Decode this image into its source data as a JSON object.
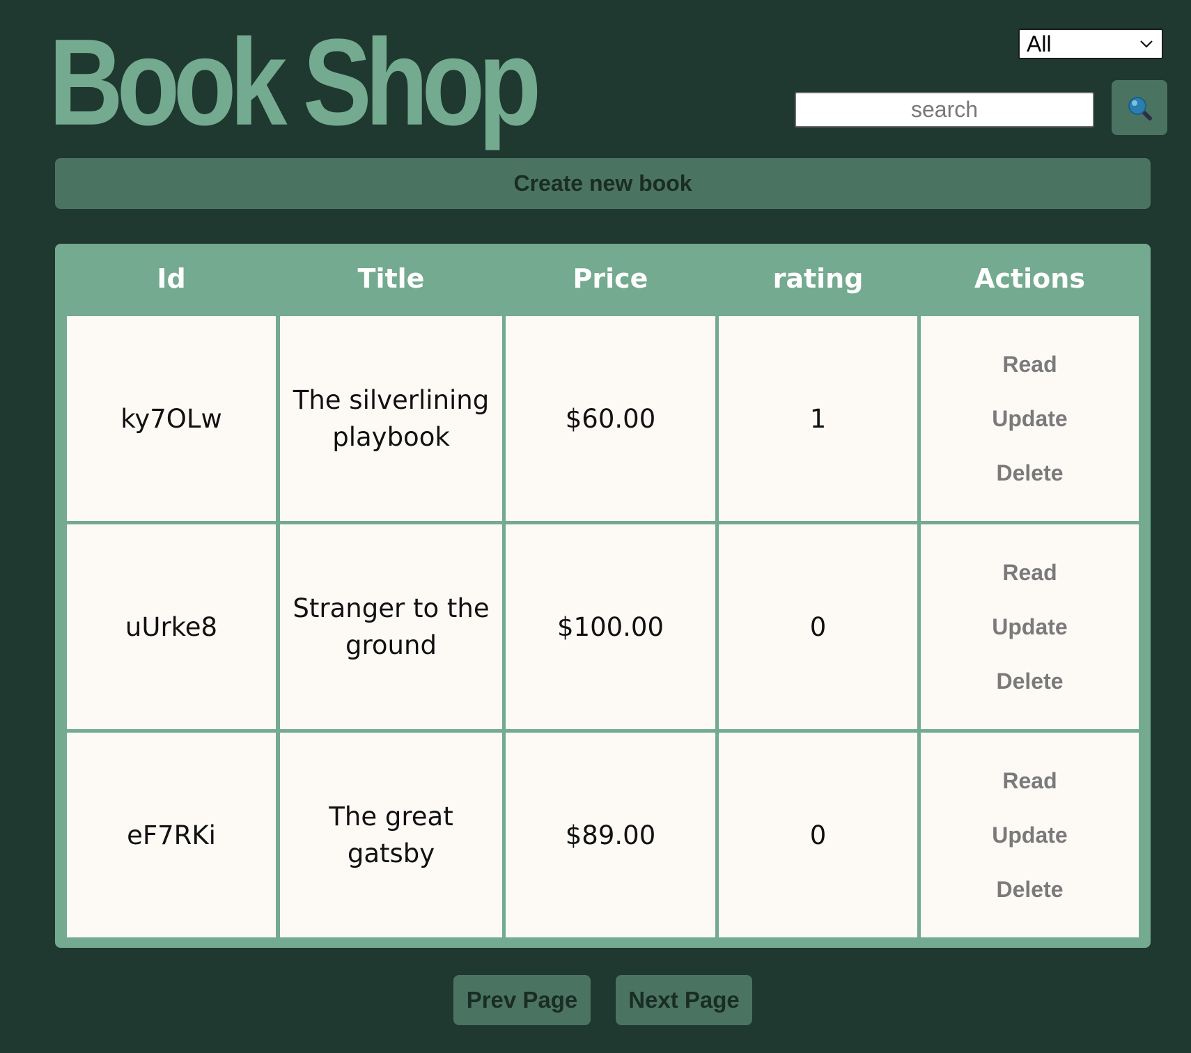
{
  "header": {
    "brand": "Book Shop",
    "category_select": {
      "value": "All"
    },
    "search": {
      "placeholder": "search"
    }
  },
  "toolbar": {
    "create_label": "Create new book"
  },
  "table": {
    "headers": [
      "Id",
      "Title",
      "Price",
      "rating",
      "Actions"
    ],
    "rows": [
      {
        "id": "ky7OLw",
        "title": "The silverlining playbook",
        "price": "$60.00",
        "rating": "1"
      },
      {
        "id": "uUrke8",
        "title": "Stranger to the ground",
        "price": "$100.00",
        "rating": "0"
      },
      {
        "id": "eF7RKi",
        "title": "The great gatsby",
        "price": "$89.00",
        "rating": "0"
      }
    ],
    "actions": {
      "read": "Read",
      "update": "Update",
      "delete": "Delete"
    }
  },
  "pagination": {
    "prev_label": "Prev Page",
    "next_label": "Next Page"
  },
  "colors": {
    "page_bg": "#1f3830",
    "accent": "#74aa8f",
    "button_bg": "#4a7461",
    "cell_bg": "#fdfaf6"
  },
  "icons": {
    "search_button": "search-icon",
    "select": "chevron-down-icon"
  }
}
